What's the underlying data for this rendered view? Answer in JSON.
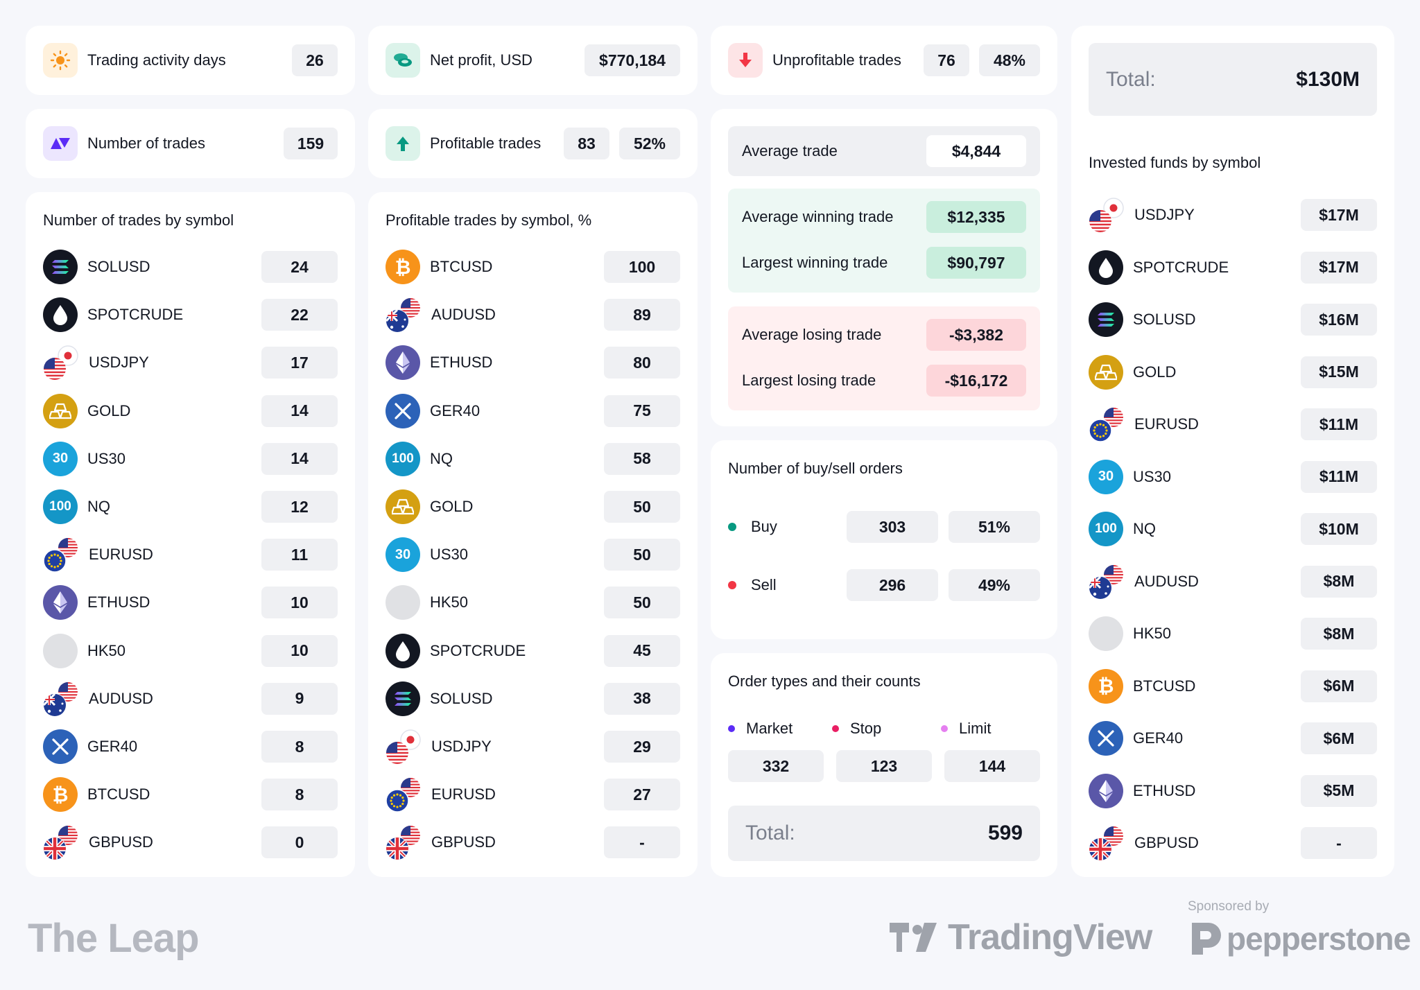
{
  "top": {
    "activity_days": {
      "label": "Trading activity days",
      "value": "26"
    },
    "net_profit": {
      "label": "Net profit, USD",
      "value": "$770,184"
    },
    "unprofitable": {
      "label": "Unprofitable trades",
      "count": "76",
      "pct": "48%"
    },
    "num_trades": {
      "label": "Number of trades",
      "value": "159"
    },
    "profitable": {
      "label": "Profitable trades",
      "count": "83",
      "pct": "52%"
    }
  },
  "col1": {
    "title": "Number of trades by symbol",
    "rows": [
      {
        "sym": "SOLUSD",
        "val": "24",
        "icon": "solana-icon"
      },
      {
        "sym": "SPOTCRUDE",
        "val": "22",
        "icon": "oil-drop-icon"
      },
      {
        "sym": "USDJPY",
        "val": "17",
        "icon": "usdjpy-flag-icon"
      },
      {
        "sym": "GOLD",
        "val": "14",
        "icon": "gold-bars-icon"
      },
      {
        "sym": "US30",
        "val": "14",
        "icon": "us30-icon"
      },
      {
        "sym": "NQ",
        "val": "12",
        "icon": "nq-100-icon"
      },
      {
        "sym": "EURUSD",
        "val": "11",
        "icon": "eurusd-flag-icon"
      },
      {
        "sym": "ETHUSD",
        "val": "10",
        "icon": "ethereum-icon"
      },
      {
        "sym": "HK50",
        "val": "10",
        "icon": "hk50-icon"
      },
      {
        "sym": "AUDUSD",
        "val": "9",
        "icon": "audusd-flag-icon"
      },
      {
        "sym": "GER40",
        "val": "8",
        "icon": "ger40-icon"
      },
      {
        "sym": "BTCUSD",
        "val": "8",
        "icon": "bitcoin-icon"
      },
      {
        "sym": "GBPUSD",
        "val": "0",
        "icon": "gbpusd-flag-icon"
      }
    ]
  },
  "col2": {
    "title": "Profitable trades by symbol, %",
    "rows": [
      {
        "sym": "BTCUSD",
        "val": "100",
        "icon": "bitcoin-icon"
      },
      {
        "sym": "AUDUSD",
        "val": "89",
        "icon": "audusd-flag-icon"
      },
      {
        "sym": "ETHUSD",
        "val": "80",
        "icon": "ethereum-icon"
      },
      {
        "sym": "GER40",
        "val": "75",
        "icon": "ger40-icon"
      },
      {
        "sym": "NQ",
        "val": "58",
        "icon": "nq-100-icon"
      },
      {
        "sym": "GOLD",
        "val": "50",
        "icon": "gold-bars-icon"
      },
      {
        "sym": "US30",
        "val": "50",
        "icon": "us30-icon"
      },
      {
        "sym": "HK50",
        "val": "50",
        "icon": "hk50-icon"
      },
      {
        "sym": "SPOTCRUDE",
        "val": "45",
        "icon": "oil-drop-icon"
      },
      {
        "sym": "SOLUSD",
        "val": "38",
        "icon": "solana-icon"
      },
      {
        "sym": "USDJPY",
        "val": "29",
        "icon": "usdjpy-flag-icon"
      },
      {
        "sym": "EURUSD",
        "val": "27",
        "icon": "eurusd-flag-icon"
      },
      {
        "sym": "GBPUSD",
        "val": "-",
        "icon": "gbpusd-flag-icon"
      }
    ]
  },
  "stats": {
    "avg_trade": {
      "label": "Average trade",
      "value": "$4,844"
    },
    "avg_win": {
      "label": "Average winning trade",
      "value": "$12,335"
    },
    "largest_win": {
      "label": "Largest winning trade",
      "value": "$90,797"
    },
    "avg_loss": {
      "label": "Average losing trade",
      "value": "-$3,382"
    },
    "largest_loss": {
      "label": "Largest losing trade",
      "value": "-$16,172"
    }
  },
  "orders": {
    "title": "Number of buy/sell orders",
    "buy": {
      "label": "Buy",
      "count": "303",
      "pct": "51%",
      "color": "#089981"
    },
    "sell": {
      "label": "Sell",
      "count": "296",
      "pct": "49%",
      "color": "#f23645"
    }
  },
  "order_types": {
    "title": "Order types and their counts",
    "types": [
      {
        "label": "Market",
        "count": "332",
        "color": "#5b2cf6"
      },
      {
        "label": "Stop",
        "count": "123",
        "color": "#e91e63"
      },
      {
        "label": "Limit",
        "count": "144",
        "color": "#e57ff0"
      }
    ],
    "total_label": "Total:",
    "total_value": "599"
  },
  "col4": {
    "total_label": "Total:",
    "total_value": "$130M",
    "title": "Invested funds by symbol",
    "rows": [
      {
        "sym": "USDJPY",
        "val": "$17M",
        "icon": "usdjpy-flag-icon"
      },
      {
        "sym": "SPOTCRUDE",
        "val": "$17M",
        "icon": "oil-drop-icon"
      },
      {
        "sym": "SOLUSD",
        "val": "$16M",
        "icon": "solana-icon"
      },
      {
        "sym": "GOLD",
        "val": "$15M",
        "icon": "gold-bars-icon"
      },
      {
        "sym": "EURUSD",
        "val": "$11M",
        "icon": "eurusd-flag-icon"
      },
      {
        "sym": "US30",
        "val": "$11M",
        "icon": "us30-icon"
      },
      {
        "sym": "NQ",
        "val": "$10M",
        "icon": "nq-100-icon"
      },
      {
        "sym": "AUDUSD",
        "val": "$8M",
        "icon": "audusd-flag-icon"
      },
      {
        "sym": "HK50",
        "val": "$8M",
        "icon": "hk50-icon"
      },
      {
        "sym": "BTCUSD",
        "val": "$6M",
        "icon": "bitcoin-icon"
      },
      {
        "sym": "GER40",
        "val": "$6M",
        "icon": "ger40-icon"
      },
      {
        "sym": "ETHUSD",
        "val": "$5M",
        "icon": "ethereum-icon"
      },
      {
        "sym": "GBPUSD",
        "val": "-",
        "icon": "gbpusd-flag-icon"
      }
    ]
  },
  "footer": {
    "brand": "The Leap",
    "tradingview": "TradingView",
    "sponsored": "Sponsored by",
    "pepperstone": "pepperstone"
  }
}
